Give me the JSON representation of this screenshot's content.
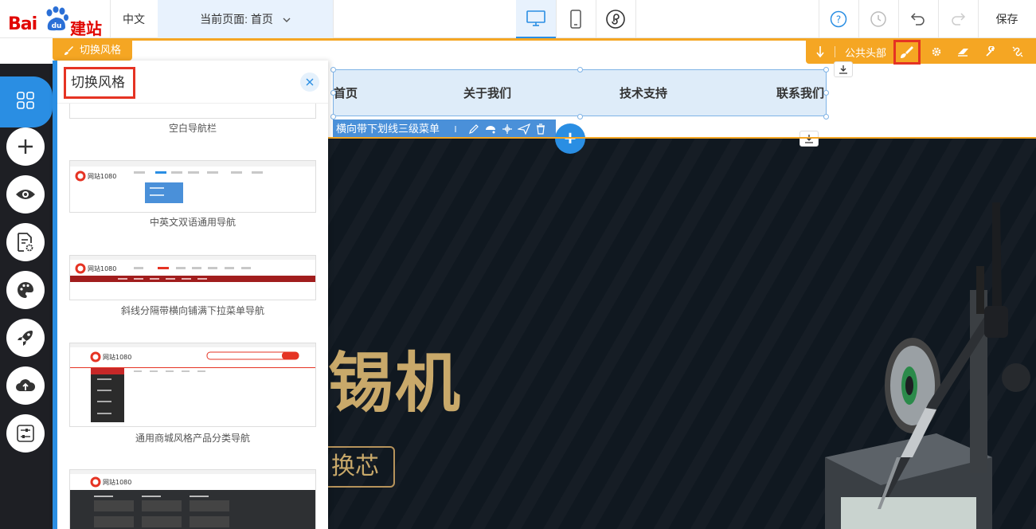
{
  "header": {
    "language": "中文",
    "current_page_label": "当前页面: 首页",
    "save_label": "保存"
  },
  "editor": {
    "switch_style_tag": "切换风格",
    "public_header_label": "公共头部",
    "menu_component_label": "横向带下划线三级菜单"
  },
  "site_nav": {
    "items": [
      "首页",
      "关于我们",
      "技术支持",
      "联系我们"
    ]
  },
  "banner": {
    "title": "锡机",
    "subtitle": "换芯"
  },
  "panel": {
    "title": "切换风格",
    "templates": [
      {
        "name": "空白导航栏"
      },
      {
        "name": "中英文双语通用导航"
      },
      {
        "name": "斜线分隔带横向铺满下拉菜单导航"
      },
      {
        "name": "通用商城风格产品分类导航"
      },
      {
        "name": ""
      }
    ],
    "thumb_brand": "网站1080"
  },
  "colors": {
    "accent_blue": "#2a8ee3",
    "orange": "#f5a623",
    "highlight_red": "#e53323",
    "sidebar_bg": "#1e1f24"
  }
}
